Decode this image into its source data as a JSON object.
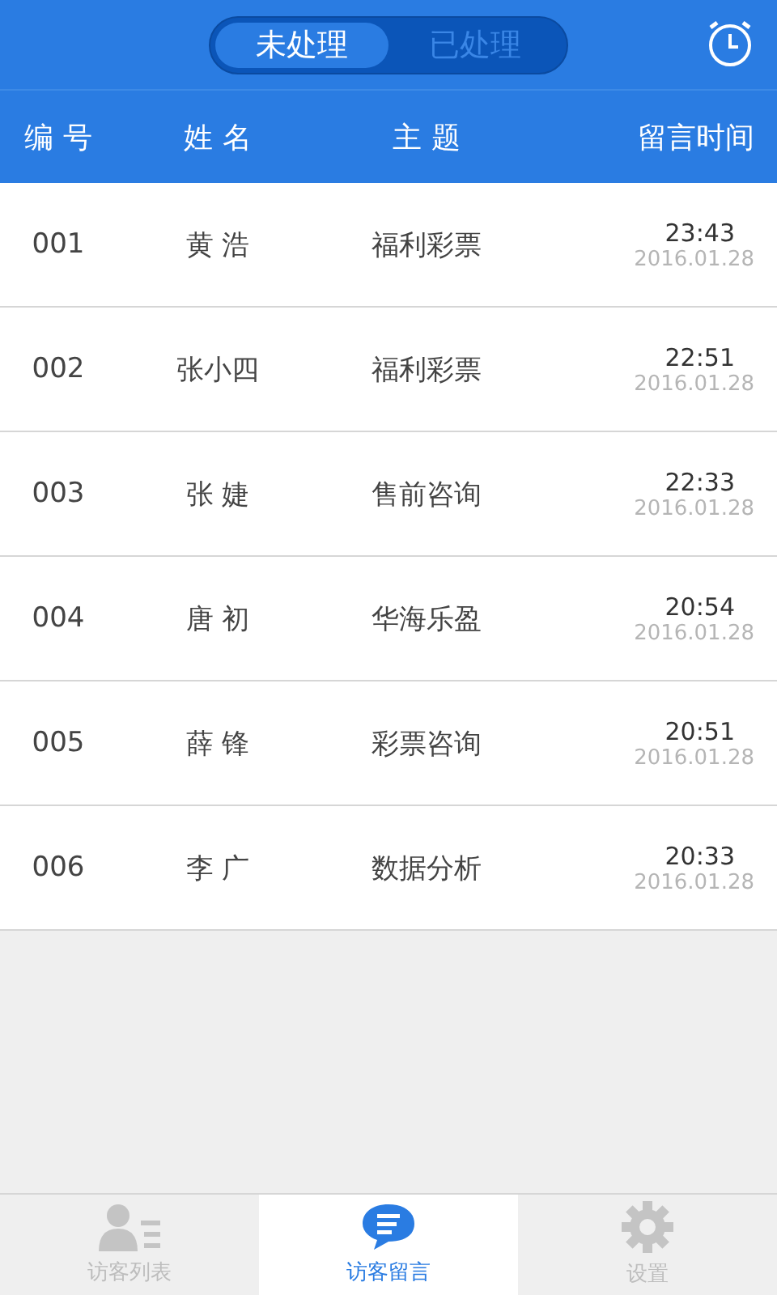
{
  "segments": [
    {
      "label": "未处理",
      "selected": true
    },
    {
      "label": "已处理",
      "selected": false
    }
  ],
  "columns": [
    "编 号",
    "姓 名",
    "主 题",
    "留言时间"
  ],
  "rows": [
    {
      "id": "001",
      "name": "黄 浩",
      "topic": "福利彩票",
      "time": "23:43",
      "date": "2016.01.28"
    },
    {
      "id": "002",
      "name": "张小四",
      "topic": "福利彩票",
      "time": "22:51",
      "date": "2016.01.28"
    },
    {
      "id": "003",
      "name": "张 婕",
      "topic": "售前咨询",
      "time": "22:33",
      "date": "2016.01.28"
    },
    {
      "id": "004",
      "name": "唐 初",
      "topic": "华海乐盈",
      "time": "20:54",
      "date": "2016.01.28"
    },
    {
      "id": "005",
      "name": "薛 锋",
      "topic": "彩票咨询",
      "time": "20:51",
      "date": "2016.01.28"
    },
    {
      "id": "006",
      "name": "李 广",
      "topic": "数据分析",
      "time": "20:33",
      "date": "2016.01.28"
    }
  ],
  "tabs": [
    {
      "label": "访客列表",
      "kind": "person",
      "selected": false
    },
    {
      "label": "访客留言",
      "kind": "chat",
      "selected": true
    },
    {
      "label": "设置",
      "kind": "gear",
      "selected": false
    }
  ]
}
